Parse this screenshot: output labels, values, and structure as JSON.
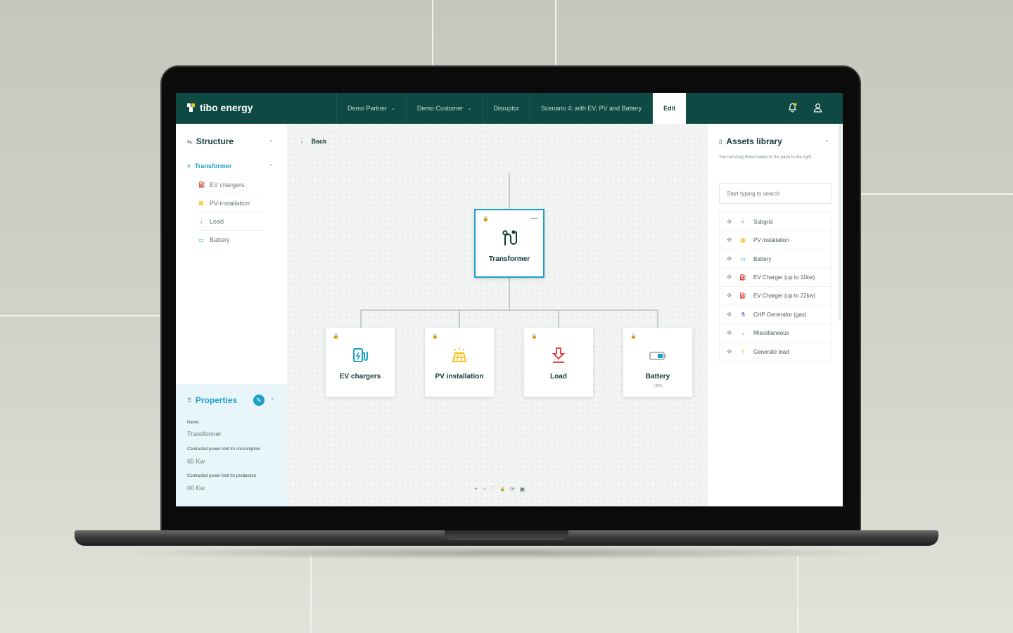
{
  "app": {
    "brand": "tibo energy",
    "tabs": [
      {
        "label": "Demo Partner",
        "dropdown": true
      },
      {
        "label": "Demo Customer",
        "dropdown": true
      },
      {
        "label": "Disruptor",
        "dropdown": false
      },
      {
        "label": "Scenario 4: with EV, PV and Battery",
        "dropdown": false
      },
      {
        "label": "Edit",
        "dropdown": false,
        "active": true
      }
    ],
    "icons": {
      "notifications": "bell-icon",
      "user": "user-icon"
    }
  },
  "structure": {
    "title": "Structure",
    "root": "Transformer",
    "children": [
      "EV chargers",
      "PV-installation",
      "Load",
      "Battery"
    ]
  },
  "properties": {
    "title": "Properties",
    "fields": [
      {
        "label": "Name:",
        "value": "Transformer"
      },
      {
        "label": "Contracted power limit for consumption",
        "value": "65 Kw"
      },
      {
        "label": "Contracted power limit for production",
        "value": "00 Kw"
      }
    ]
  },
  "canvas": {
    "back_label": "Back",
    "root_node": {
      "label": "Transformer",
      "icon": "transformer-icon",
      "color": "#123b36"
    },
    "child_nodes": [
      {
        "label": "EV chargers",
        "icon": "ev-charger-icon",
        "color": "#1aa0c8"
      },
      {
        "label": "PV installation",
        "icon": "solar-panel-icon",
        "color": "#f4c21a"
      },
      {
        "label": "Load",
        "icon": "load-arrow-icon",
        "color": "#e04848"
      },
      {
        "label": "Battery",
        "icon": "battery-icon",
        "color": "#1aa0c8",
        "sub": "| 00%"
      }
    ],
    "zoom_controls": [
      "+",
      "−",
      "⛶",
      "🔒",
      "⟳",
      "▣"
    ]
  },
  "assets": {
    "title": "Assets library",
    "hint": "You can drag these nodes to the pane to the right",
    "search_placeholder": "Start typing to search",
    "items": [
      {
        "label": "Subgrid",
        "icon": "subgrid-icon",
        "color": "#123b36"
      },
      {
        "label": "PV installation",
        "icon": "solar-icon",
        "color": "#f4c21a"
      },
      {
        "label": "Battery",
        "icon": "battery-icon",
        "color": "#1aa0c8"
      },
      {
        "label": "EV Charger (up to 11kw)",
        "icon": "ev-charger-icon",
        "color": "#1aa0c8"
      },
      {
        "label": "EV Charger (up to 22kw)",
        "icon": "ev-charger-icon",
        "color": "#3a4fb0"
      },
      {
        "label": "CHP Generator (gas)",
        "icon": "generator-icon",
        "color": "#7a5ac8"
      },
      {
        "label": "Miscellaneous",
        "icon": "misc-icon",
        "color": "#e04848"
      },
      {
        "label": "Generate load",
        "icon": "lightning-icon",
        "color": "#f4c21a"
      }
    ]
  },
  "colors": {
    "header": "#0e4a43",
    "accent": "#1aa0c8",
    "properties_bg": "#e8f6fb"
  }
}
